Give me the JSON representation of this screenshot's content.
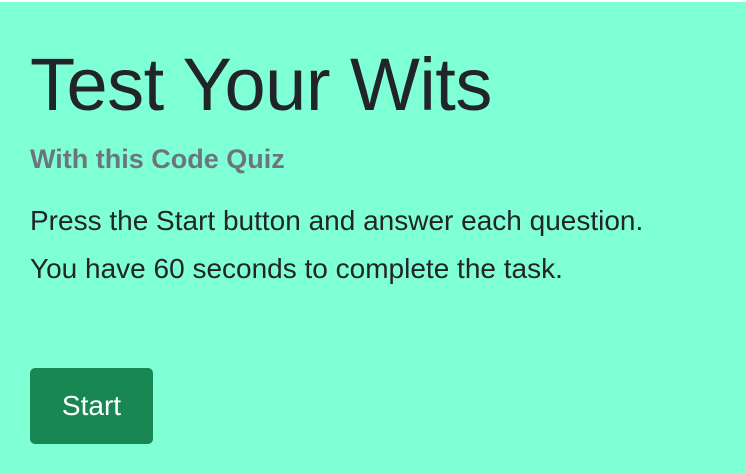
{
  "quiz": {
    "title": "Test Your Wits",
    "subtitle": "With this Code Quiz",
    "instructions": [
      "Press the Start button and answer each question.",
      "You have 60 seconds to complete the task."
    ],
    "start_label": "Start"
  },
  "colors": {
    "background": "#7fffd4",
    "title": "#212529",
    "subtitle": "#6c757d",
    "button": "#198754",
    "button_text": "#ffffff"
  }
}
